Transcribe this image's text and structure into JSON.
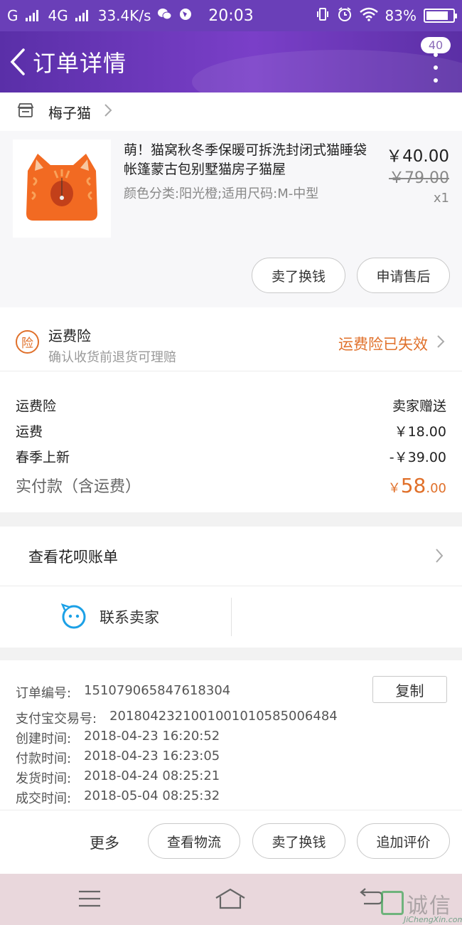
{
  "status_bar": {
    "carrier": "G",
    "network": "4G",
    "speed": "33.4K/s",
    "time": "20:03",
    "battery": "83%",
    "battery_level": 0.83
  },
  "header": {
    "title": "订单详情",
    "badge": "40"
  },
  "shop": {
    "name": "梅子猫"
  },
  "product": {
    "title": "萌！猫窝秋冬季保暖可拆洗封闭式猫睡袋帐篷蒙古包别墅猫房子猫屋",
    "spec": "颜色分类:阳光橙;适用尺码:M-中型",
    "price": "￥40.00",
    "original_price": "￥79.00",
    "quantity": "x1",
    "buttons": {
      "sell": "卖了换钱",
      "after_sales": "申请售后"
    }
  },
  "insurance": {
    "icon_text": "险",
    "title": "运费险",
    "subtitle": "确认收货前退货可理赔",
    "status": "运费险已失效"
  },
  "fees": {
    "rows": [
      {
        "label": "运费险",
        "value": "卖家赠送"
      },
      {
        "label": "运费",
        "value": "￥18.00"
      },
      {
        "label": "春季上新",
        "value": "-￥39.00"
      }
    ],
    "total_label": "实付款（含运费）",
    "total_currency": "￥",
    "total_int": "58",
    "total_dec": ".00"
  },
  "huabei": {
    "label": "查看花呗账单"
  },
  "contact": {
    "label": "联系卖家"
  },
  "order_info": {
    "copy_label": "复制",
    "rows": [
      {
        "key": "订单编号:",
        "value": "151079065847618304"
      },
      {
        "key": "支付宝交易号:",
        "value": "2018042321001001010585006484"
      },
      {
        "key": "创建时间:",
        "value": "2018-04-23 16:20:52"
      },
      {
        "key": "付款时间:",
        "value": "2018-04-23 16:23:05"
      },
      {
        "key": "发货时间:",
        "value": "2018-04-24 08:25:21"
      },
      {
        "key": "成交时间:",
        "value": "2018-05-04 08:25:32"
      }
    ]
  },
  "actions": {
    "more": "更多",
    "logistics": "查看物流",
    "sell": "卖了换钱",
    "review": "追加评价"
  },
  "watermark": {
    "main": "诚信",
    "sub": "JiChengXin.com"
  },
  "colors": {
    "accent_orange": "#e0702a",
    "header_purple": "#6a3fb8"
  }
}
